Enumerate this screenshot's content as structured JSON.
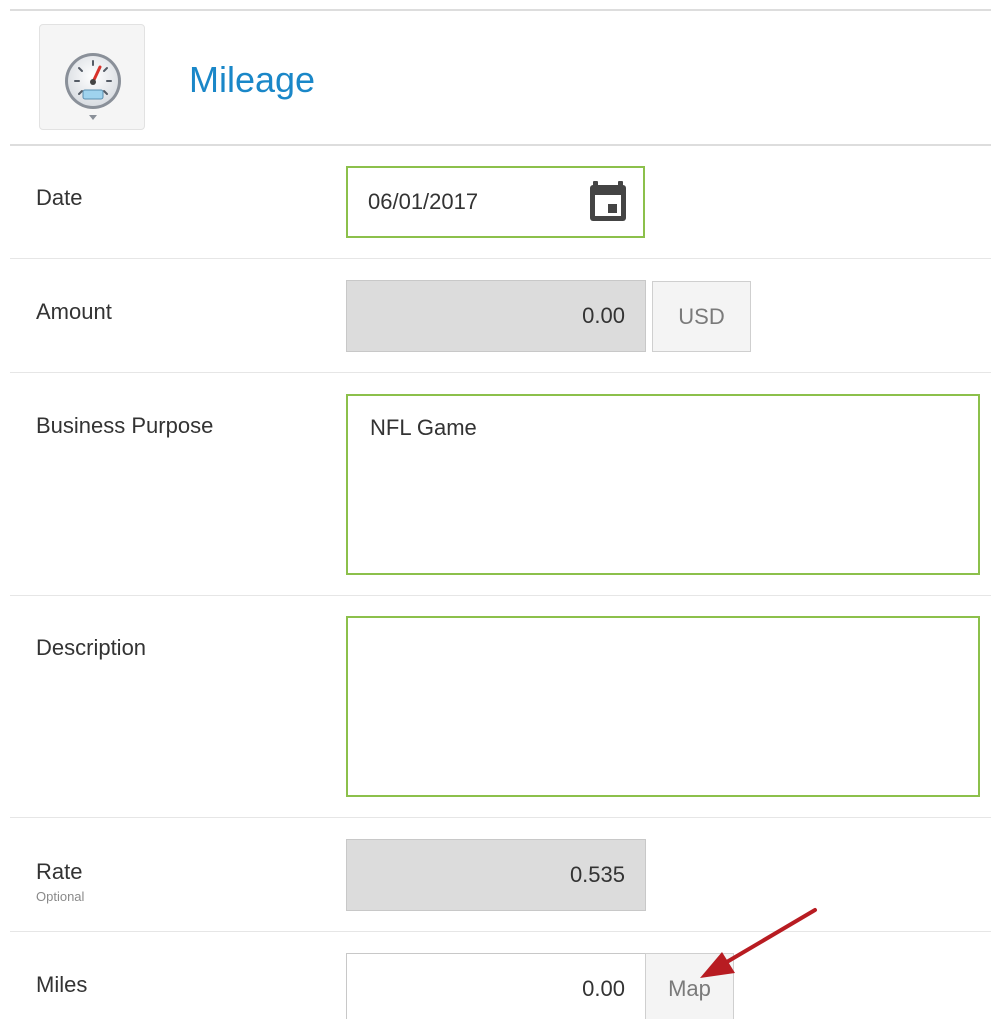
{
  "header": {
    "title": "Mileage",
    "icon": "speedometer-icon"
  },
  "form": {
    "date": {
      "label": "Date",
      "value": "06/01/2017",
      "icon": "calendar-icon"
    },
    "amount": {
      "label": "Amount",
      "value": "0.00",
      "currency": "USD"
    },
    "business_purpose": {
      "label": "Business Purpose",
      "value": "NFL Game"
    },
    "description": {
      "label": "Description",
      "value": ""
    },
    "rate": {
      "label": "Rate",
      "sublabel": "Optional",
      "value": "0.535"
    },
    "miles": {
      "label": "Miles",
      "value": "0.00",
      "map_button": "Map"
    }
  },
  "colors": {
    "accent": "#1a87c8",
    "focus_border": "#8cc04b",
    "readonly_bg": "#dcdcdc",
    "annotation_arrow": "#b81c22"
  }
}
